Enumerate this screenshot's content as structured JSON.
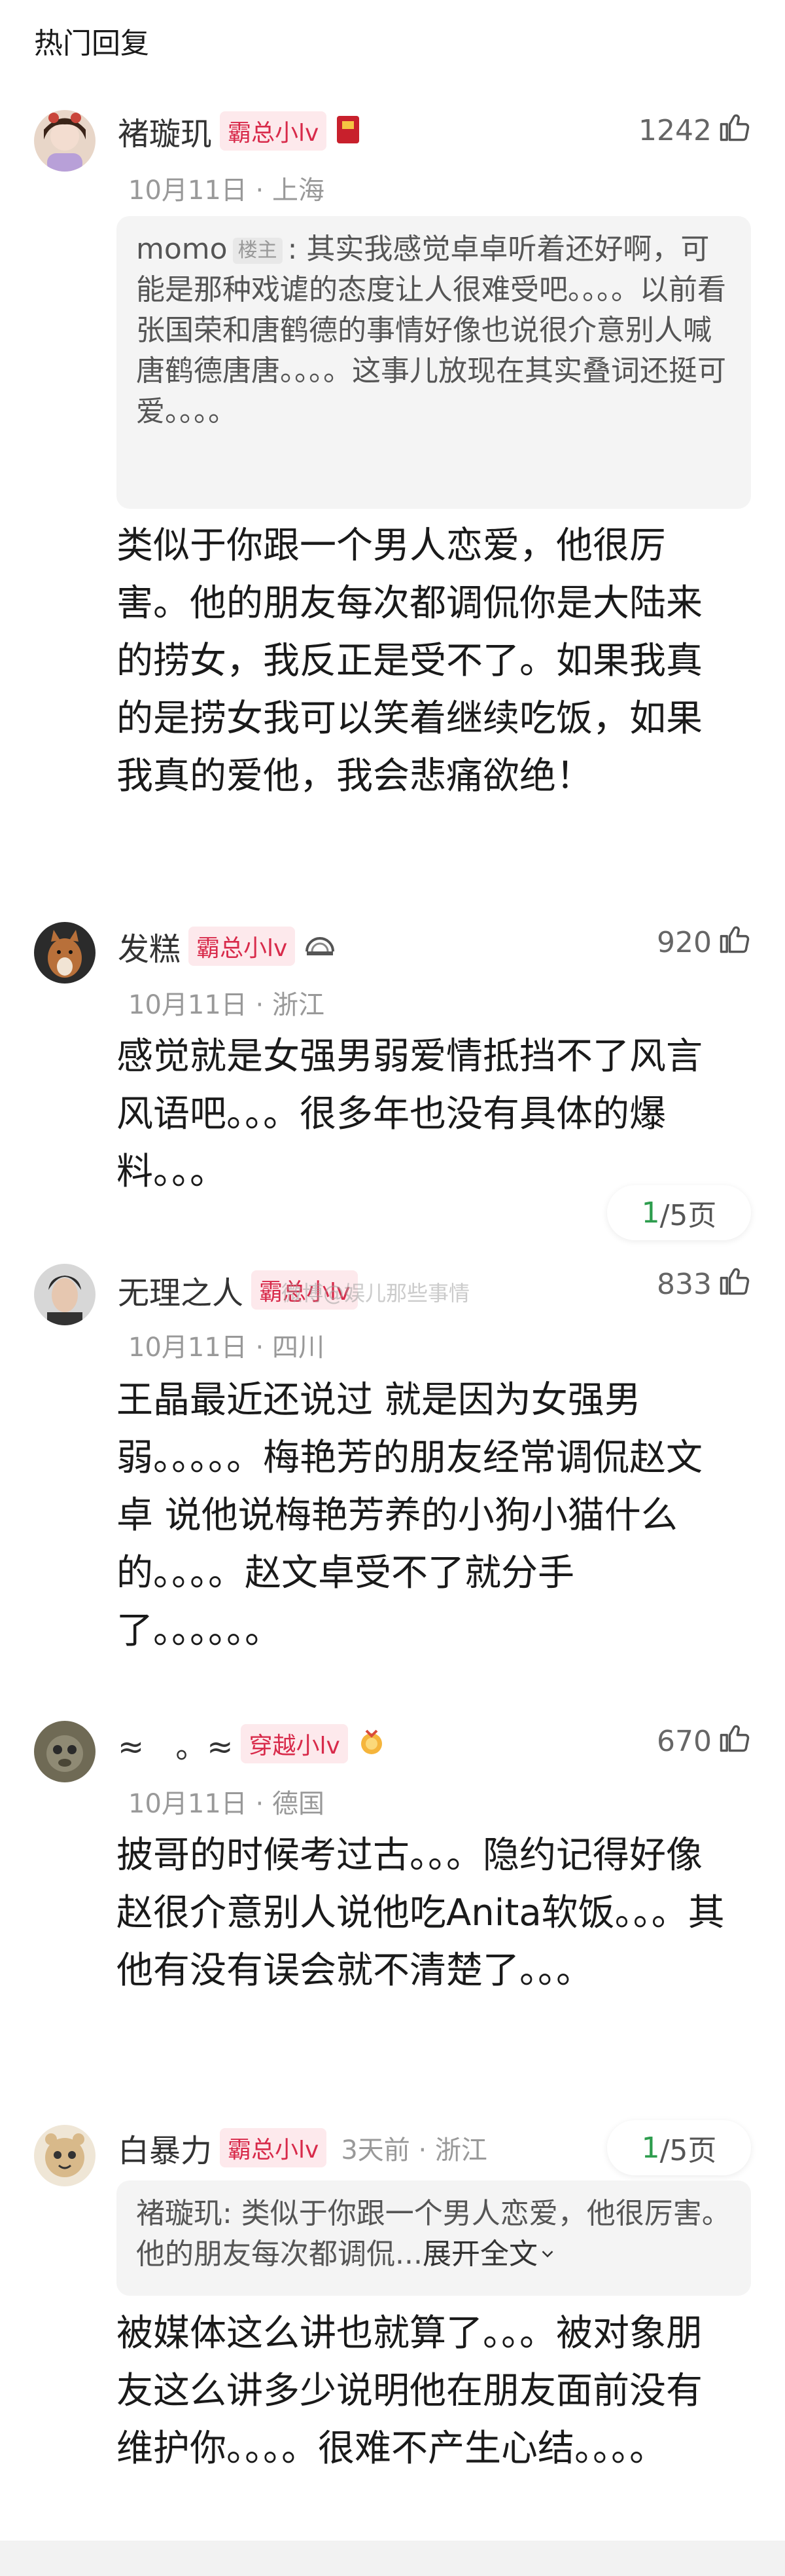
{
  "section": {
    "title": "热门回复"
  },
  "comments": [
    {
      "username": "褚璇玑",
      "badge": "霸总小lv",
      "likes": "1242",
      "date": "10月11日",
      "location": "上海",
      "quote": {
        "author": "momo",
        "tag": "楼主",
        "text": ": 其实我感觉卓卓听着还好啊，可能是那种戏谑的态度让人很难受吧。。。。以前看张国荣和唐鹤德的事情好像也说很介意别人喊唐鹤德唐唐。。。。这事儿放现在其实叠词还挺可爱。。。。"
      },
      "body": "类似于你跟一个男人恋爱，他很厉害。他的朋友每次都调侃你是大陆来的捞女，我反正是受不了。如果我真的是捞女我可以笑着继续吃饭，如果我真的爱他，我会悲痛欲绝！"
    },
    {
      "username": "发糕",
      "badge": "霸总小lv",
      "likes": "920",
      "date": "10月11日",
      "location": "浙江",
      "body": "感觉就是女强男弱爱情抵挡不了风言风语吧。。。很多年也没有具体的爆料。。。",
      "pager": {
        "current": "1",
        "total": "/5页"
      }
    },
    {
      "username": "无理之人",
      "badge": "霸总小lv",
      "likes": "833",
      "date": "10月11日",
      "location": "四川",
      "body": "王晶最近还说过 就是因为女强男弱。。。。。梅艳芳的朋友经常调侃赵文卓 说他说梅艳芳养的小狗小猫什么的。。。。赵文卓受不了就分手了。。。。。。"
    },
    {
      "username": "≈　。≈",
      "badge": "穿越小lv",
      "likes": "670",
      "date": "10月11日",
      "location": "德国",
      "body": "披哥的时候考过古。。。隐约记得好像赵很介意别人说他吃Anita软饭。。。其他有没有误会就不清楚了。。。"
    },
    {
      "username": "白暴力",
      "badge": "霸总小lv",
      "time": "3天前",
      "location": "浙江",
      "quote": {
        "text": "褚璇玑: 类似于你跟一个男人恋爱，他很厉害。他的朋友每次都调侃...",
        "expand": "展开全文"
      },
      "body": "被媒体这么讲也就算了。。。被对象朋友这么讲多少说明他在朋友面前没有维护你。。。。很难不产生心结。。。。",
      "pager": {
        "current": "1",
        "total": "/5页"
      }
    }
  ],
  "watermark": "微博@娱儿那些事情",
  "colors": {
    "badge_bg": "#fde9ec",
    "badge_text": "#d82a4a",
    "pager_current": "#2e9d4e",
    "meta": "#999999"
  }
}
